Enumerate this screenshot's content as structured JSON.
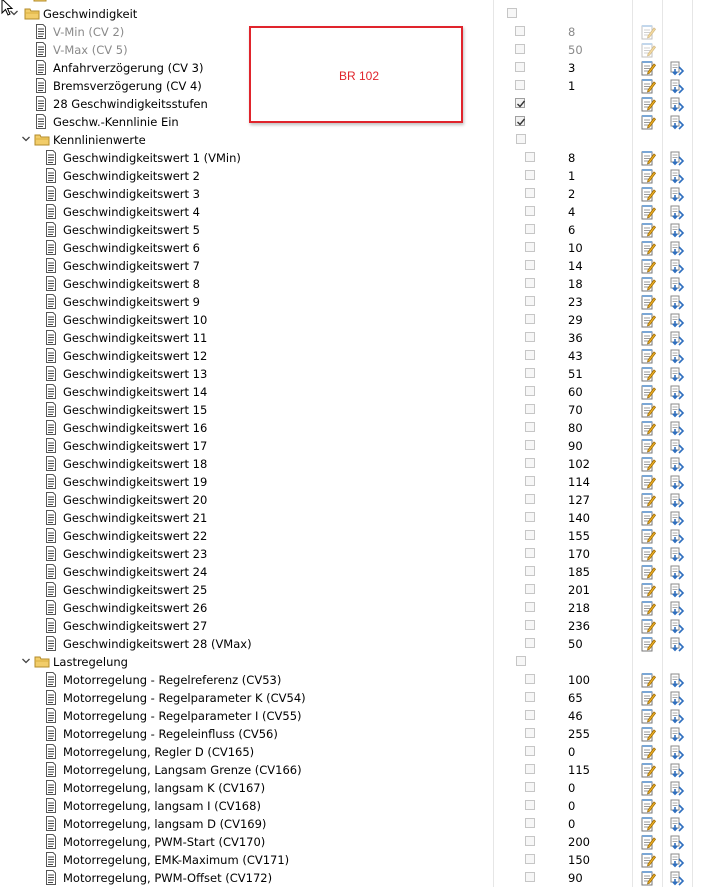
{
  "annotation": {
    "text": "BR 102",
    "color": "#e0242c"
  },
  "colors": {
    "folder": "#f2cd6a",
    "disabled_text": "#8a8a8a",
    "write_icon": "#2f6fbf"
  },
  "icons": {
    "expand": "chevron-down-icon",
    "folder": "folder-icon",
    "item": "document-icon",
    "edit": "edit-notepad-icon",
    "write": "write-cv-icon",
    "cursor": "mouse-cursor-icon"
  },
  "tree": [
    {
      "type": "folder",
      "label": "Geschwindigkeit",
      "level": 0
    },
    {
      "type": "item",
      "label": "V-Min (CV 2)",
      "level": 1,
      "value": "8",
      "checked": false,
      "disabled": true
    },
    {
      "type": "item",
      "label": "V-Max (CV 5)",
      "level": 1,
      "value": "50",
      "checked": false,
      "disabled": true
    },
    {
      "type": "item",
      "label": "Anfahrverzögerung (CV 3)",
      "level": 1,
      "value": "3",
      "checked": false,
      "disabled": false
    },
    {
      "type": "item",
      "label": "Bremsverzögerung (CV 4)",
      "level": 1,
      "value": "1",
      "checked": false,
      "disabled": false
    },
    {
      "type": "item",
      "label": "28 Geschwindigkeitsstufen",
      "level": 1,
      "value": "",
      "checked": true,
      "disabled": false
    },
    {
      "type": "item",
      "label": "Geschw.-Kennlinie Ein",
      "level": 1,
      "value": "",
      "checked": true,
      "disabled": false
    },
    {
      "type": "folder",
      "label": "Kennlinienwerte",
      "level": 1
    },
    {
      "type": "item",
      "label": "Geschwindigkeitswert 1 (VMin)",
      "level": 2,
      "value": "8"
    },
    {
      "type": "item",
      "label": "Geschwindigkeitswert 2",
      "level": 2,
      "value": "1"
    },
    {
      "type": "item",
      "label": "Geschwindigkeitswert 3",
      "level": 2,
      "value": "2"
    },
    {
      "type": "item",
      "label": "Geschwindigkeitswert 4",
      "level": 2,
      "value": "4"
    },
    {
      "type": "item",
      "label": "Geschwindigkeitswert 5",
      "level": 2,
      "value": "6"
    },
    {
      "type": "item",
      "label": "Geschwindigkeitswert 6",
      "level": 2,
      "value": "10"
    },
    {
      "type": "item",
      "label": "Geschwindigkeitswert 7",
      "level": 2,
      "value": "14"
    },
    {
      "type": "item",
      "label": "Geschwindigkeitswert 8",
      "level": 2,
      "value": "18"
    },
    {
      "type": "item",
      "label": "Geschwindigkeitswert 9",
      "level": 2,
      "value": "23"
    },
    {
      "type": "item",
      "label": "Geschwindigkeitswert 10",
      "level": 2,
      "value": "29"
    },
    {
      "type": "item",
      "label": "Geschwindigkeitswert 11",
      "level": 2,
      "value": "36"
    },
    {
      "type": "item",
      "label": "Geschwindigkeitswert 12",
      "level": 2,
      "value": "43"
    },
    {
      "type": "item",
      "label": "Geschwindigkeitswert 13",
      "level": 2,
      "value": "51"
    },
    {
      "type": "item",
      "label": "Geschwindigkeitswert 14",
      "level": 2,
      "value": "60"
    },
    {
      "type": "item",
      "label": "Geschwindigkeitswert 15",
      "level": 2,
      "value": "70"
    },
    {
      "type": "item",
      "label": "Geschwindigkeitswert 16",
      "level": 2,
      "value": "80"
    },
    {
      "type": "item",
      "label": "Geschwindigkeitswert 17",
      "level": 2,
      "value": "90"
    },
    {
      "type": "item",
      "label": "Geschwindigkeitswert 18",
      "level": 2,
      "value": "102"
    },
    {
      "type": "item",
      "label": "Geschwindigkeitswert 19",
      "level": 2,
      "value": "114"
    },
    {
      "type": "item",
      "label": "Geschwindigkeitswert 20",
      "level": 2,
      "value": "127"
    },
    {
      "type": "item",
      "label": "Geschwindigkeitswert 21",
      "level": 2,
      "value": "140"
    },
    {
      "type": "item",
      "label": "Geschwindigkeitswert 22",
      "level": 2,
      "value": "155"
    },
    {
      "type": "item",
      "label": "Geschwindigkeitswert 23",
      "level": 2,
      "value": "170"
    },
    {
      "type": "item",
      "label": "Geschwindigkeitswert 24",
      "level": 2,
      "value": "185"
    },
    {
      "type": "item",
      "label": "Geschwindigkeitswert 25",
      "level": 2,
      "value": "201"
    },
    {
      "type": "item",
      "label": "Geschwindigkeitswert 26",
      "level": 2,
      "value": "218"
    },
    {
      "type": "item",
      "label": "Geschwindigkeitswert 27",
      "level": 2,
      "value": "236"
    },
    {
      "type": "item",
      "label": "Geschwindigkeitswert 28 (VMax)",
      "level": 2,
      "value": "50"
    },
    {
      "type": "folder",
      "label": "Lastregelung",
      "level": 1
    },
    {
      "type": "item",
      "label": "Motorregelung - Regelreferenz (CV53)",
      "level": 2,
      "value": "100"
    },
    {
      "type": "item",
      "label": "Motorregelung - Regelparameter K (CV54)",
      "level": 2,
      "value": "65"
    },
    {
      "type": "item",
      "label": "Motorregelung - Regelparameter I (CV55)",
      "level": 2,
      "value": "46"
    },
    {
      "type": "item",
      "label": "Motorregelung - Regeleinfluss (CV56)",
      "level": 2,
      "value": "255"
    },
    {
      "type": "item",
      "label": "Motorregelung, Regler D (CV165)",
      "level": 2,
      "value": "0"
    },
    {
      "type": "item",
      "label": "Motorregelung, Langsam Grenze (CV166)",
      "level": 2,
      "value": "115"
    },
    {
      "type": "item",
      "label": "Motorregelung, langsam K (CV167)",
      "level": 2,
      "value": "0"
    },
    {
      "type": "item",
      "label": " Motorregelung, langsam I (CV168)",
      "level": 2,
      "value": "0"
    },
    {
      "type": "item",
      "label": "Motorregelung, langsam D (CV169)",
      "level": 2,
      "value": "0"
    },
    {
      "type": "item",
      "label": "Motorregelung, PWM-Start (CV170)",
      "level": 2,
      "value": "200"
    },
    {
      "type": "item",
      "label": "Motorregelung, EMK-Maximum (CV171)",
      "level": 2,
      "value": "150"
    },
    {
      "type": "item",
      "label": "Motorregelung, PWM-Offset (CV172)",
      "level": 2,
      "value": "90"
    }
  ]
}
